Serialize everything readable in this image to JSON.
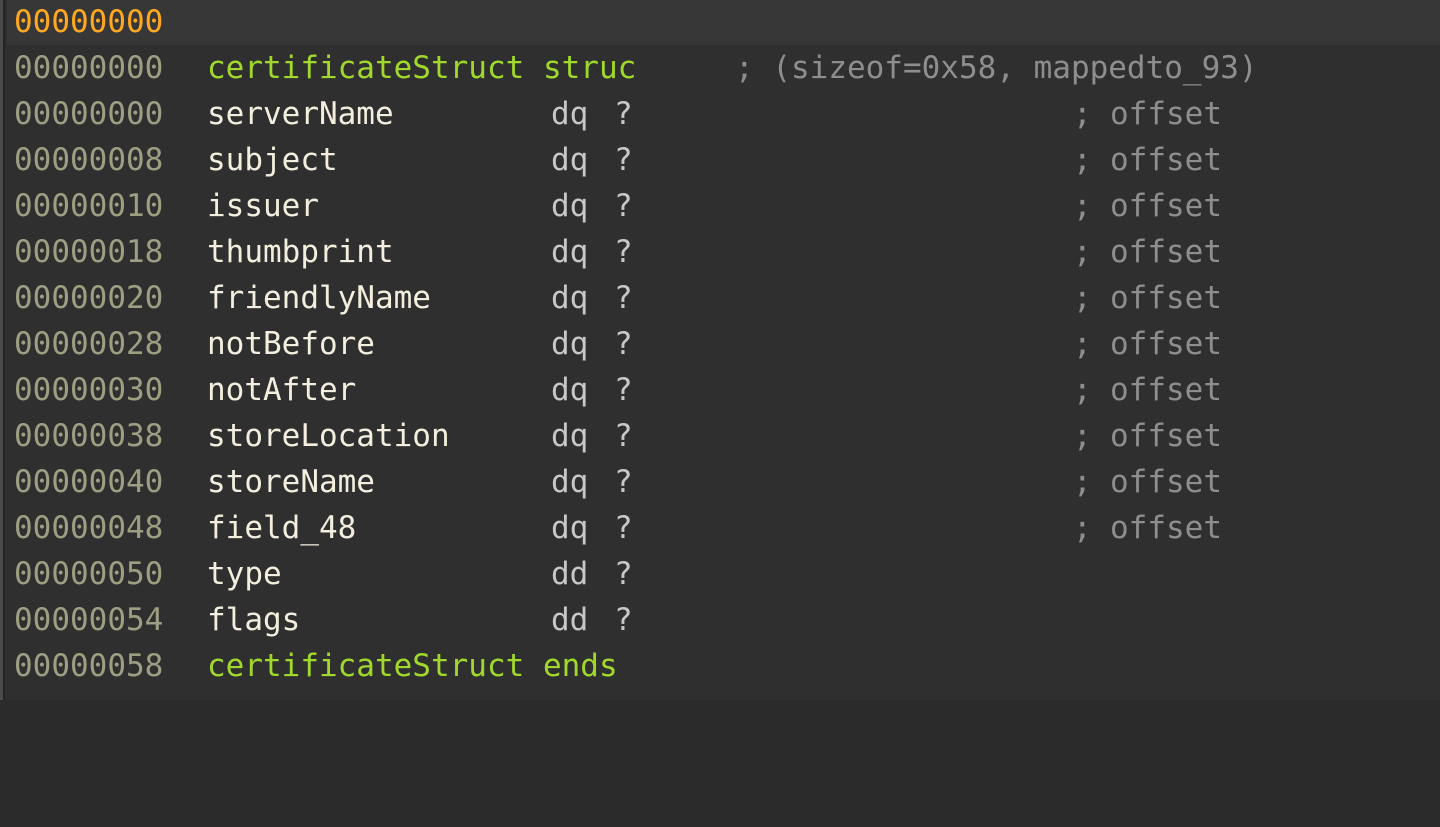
{
  "view": {
    "title": "IDA Structures View",
    "background_color": "#2f2f2f",
    "header_row_color": "#373737",
    "gutter_color": "#4a4a4a"
  },
  "colors": {
    "address": "#9e9e82",
    "address_selected": "#ffa820",
    "field_name": "#f3eedd",
    "keyword": "#a0d82c",
    "data_type": "#c8c8c8",
    "value": "#c8c8c8",
    "comment": "#8e8e8e"
  },
  "header": {
    "address": "00000000"
  },
  "struct": {
    "name": "certificateStruct",
    "open_keyword": "struc",
    "close_keyword": "ends",
    "open_address": "00000000",
    "close_address": "00000058",
    "declaration_comment": "; (sizeof=0x58, mappedto_93)",
    "size": "0x58",
    "mapped_to": "mappedto_93"
  },
  "members": [
    {
      "address": "00000000",
      "name": "serverName",
      "type": "dq",
      "value": "?",
      "comment_mark": ";",
      "comment": "offset",
      "mono": false
    },
    {
      "address": "00000008",
      "name": "subject",
      "type": "dq",
      "value": "?",
      "comment_mark": ";",
      "comment": "offset",
      "mono": false
    },
    {
      "address": "00000010",
      "name": "issuer",
      "type": "dq",
      "value": "?",
      "comment_mark": ";",
      "comment": "offset",
      "mono": false
    },
    {
      "address": "00000018",
      "name": "thumbprint",
      "type": "dq",
      "value": "?",
      "comment_mark": ";",
      "comment": "offset",
      "mono": false
    },
    {
      "address": "00000020",
      "name": "friendlyName",
      "type": "dq",
      "value": "?",
      "comment_mark": ";",
      "comment": "offset",
      "mono": false
    },
    {
      "address": "00000028",
      "name": "notBefore",
      "type": "dq",
      "value": "?",
      "comment_mark": ";",
      "comment": "offset",
      "mono": false
    },
    {
      "address": "00000030",
      "name": "notAfter",
      "type": "dq",
      "value": "?",
      "comment_mark": ";",
      "comment": "offset",
      "mono": false
    },
    {
      "address": "00000038",
      "name": "storeLocation",
      "type": "dq",
      "value": "?",
      "comment_mark": ";",
      "comment": "offset",
      "mono": false
    },
    {
      "address": "00000040",
      "name": "storeName",
      "type": "dq",
      "value": "?",
      "comment_mark": ";",
      "comment": "offset",
      "mono": false
    },
    {
      "address": "00000048",
      "name": "field_48",
      "type": "dq",
      "value": "?",
      "comment_mark": ";",
      "comment": "offset",
      "mono": true
    },
    {
      "address": "00000050",
      "name": "type",
      "type": "dd",
      "value": "?",
      "comment_mark": "",
      "comment": "",
      "mono": false
    },
    {
      "address": "00000054",
      "name": "flags",
      "type": "dd",
      "value": "?",
      "comment_mark": "",
      "comment": "",
      "mono": false
    }
  ]
}
